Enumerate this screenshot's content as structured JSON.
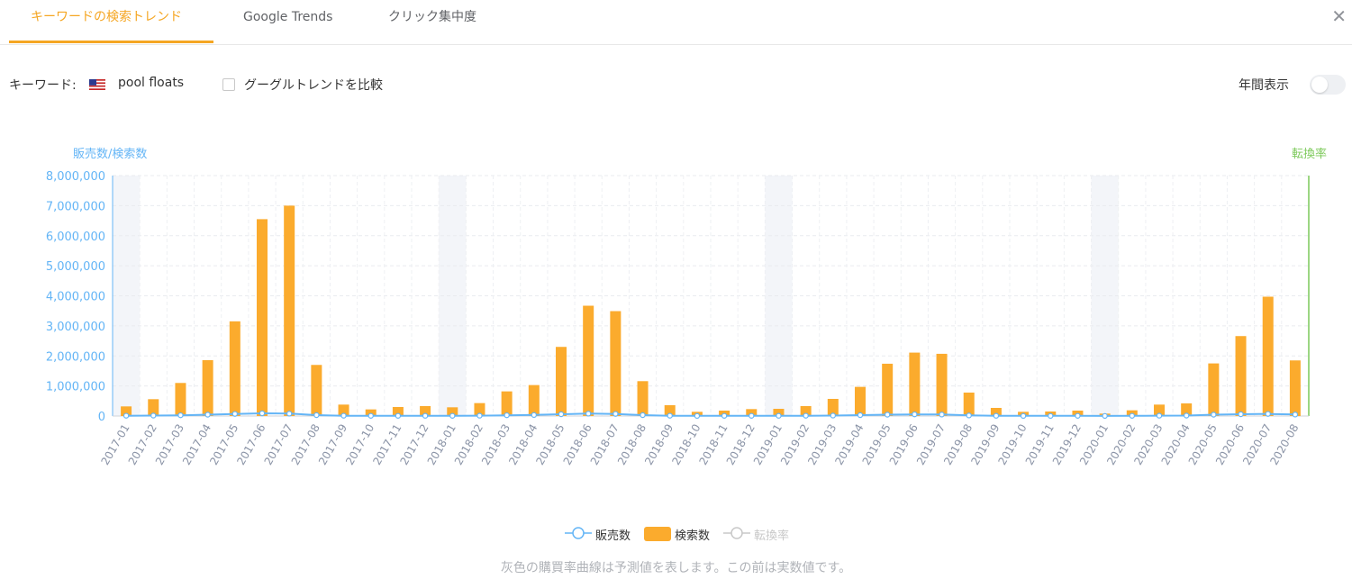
{
  "tabs": [
    {
      "label": "キーワードの検索トレンド",
      "active": true
    },
    {
      "label": "Google Trends",
      "active": false
    },
    {
      "label": "クリック集中度",
      "active": false
    }
  ],
  "close_icon": "close-icon",
  "keyword": {
    "label": "キーワード:",
    "flag_icon": "us-flag-icon",
    "value": "pool floats",
    "compare_label": "グーグルトレンドを比較",
    "compare_checked": false
  },
  "annual": {
    "label": "年間表示",
    "enabled": false
  },
  "legend": [
    {
      "label": "販売数",
      "color": "#64b5f6"
    },
    {
      "label": "検索数",
      "color": "#fbab2d"
    },
    {
      "label": "転換率",
      "color": "#c8c8c8"
    }
  ],
  "note": "灰色の購買率曲線は予測値を表します。この前は実数値です。",
  "chart_data": {
    "type": "bar",
    "left_axis_label": "販売数/検索数",
    "right_axis_label": "転換率",
    "ylim": [
      0,
      8000000
    ],
    "yticks": [
      "0",
      "1,000,000",
      "2,000,000",
      "3,000,000",
      "4,000,000",
      "5,000,000",
      "6,000,000",
      "7,000,000",
      "8,000,000"
    ],
    "colors": {
      "search": "#fbab2d",
      "sales": "#64b5f6",
      "left_axis": "#64b5f6",
      "right_axis": "#7cc95a",
      "band": "#f3f5f9"
    },
    "categories": [
      "2017-01",
      "2017-02",
      "2017-03",
      "2017-04",
      "2017-05",
      "2017-06",
      "2017-07",
      "2017-08",
      "2017-09",
      "2017-10",
      "2017-11",
      "2017-12",
      "2018-01",
      "2018-02",
      "2018-03",
      "2018-04",
      "2018-05",
      "2018-06",
      "2018-07",
      "2018-08",
      "2018-09",
      "2018-10",
      "2018-11",
      "2018-12",
      "2019-01",
      "2019-02",
      "2019-03",
      "2019-04",
      "2019-05",
      "2019-06",
      "2019-07",
      "2019-08",
      "2019-09",
      "2019-10",
      "2019-11",
      "2019-12",
      "2020-01",
      "2020-02",
      "2020-03",
      "2020-04",
      "2020-05",
      "2020-06",
      "2020-07",
      "2020-08"
    ],
    "series": [
      {
        "name": "検索数",
        "kind": "bar",
        "values": [
          320000,
          560000,
          1100000,
          1860000,
          3150000,
          6550000,
          7000000,
          1700000,
          380000,
          220000,
          300000,
          330000,
          290000,
          430000,
          820000,
          1030000,
          2300000,
          3670000,
          3490000,
          1160000,
          360000,
          140000,
          180000,
          230000,
          240000,
          330000,
          570000,
          970000,
          1740000,
          2110000,
          2070000,
          780000,
          270000,
          140000,
          150000,
          180000,
          80000,
          190000,
          380000,
          420000,
          1750000,
          2660000,
          3970000,
          1850000
        ]
      },
      {
        "name": "販売数",
        "kind": "line",
        "values": [
          10000,
          15000,
          25000,
          45000,
          70000,
          90000,
          80000,
          30000,
          10000,
          6000,
          7000,
          8000,
          7000,
          12000,
          25000,
          35000,
          60000,
          80000,
          70000,
          30000,
          10000,
          5000,
          6000,
          7000,
          8000,
          10000,
          16000,
          30000,
          45000,
          55000,
          50000,
          20000,
          8000,
          5000,
          5000,
          6000,
          3000,
          6000,
          12000,
          15000,
          45000,
          60000,
          70000,
          50000
        ]
      }
    ],
    "shaded_months": [
      "2017-01",
      "2018-01",
      "2019-01",
      "2020-01"
    ]
  }
}
